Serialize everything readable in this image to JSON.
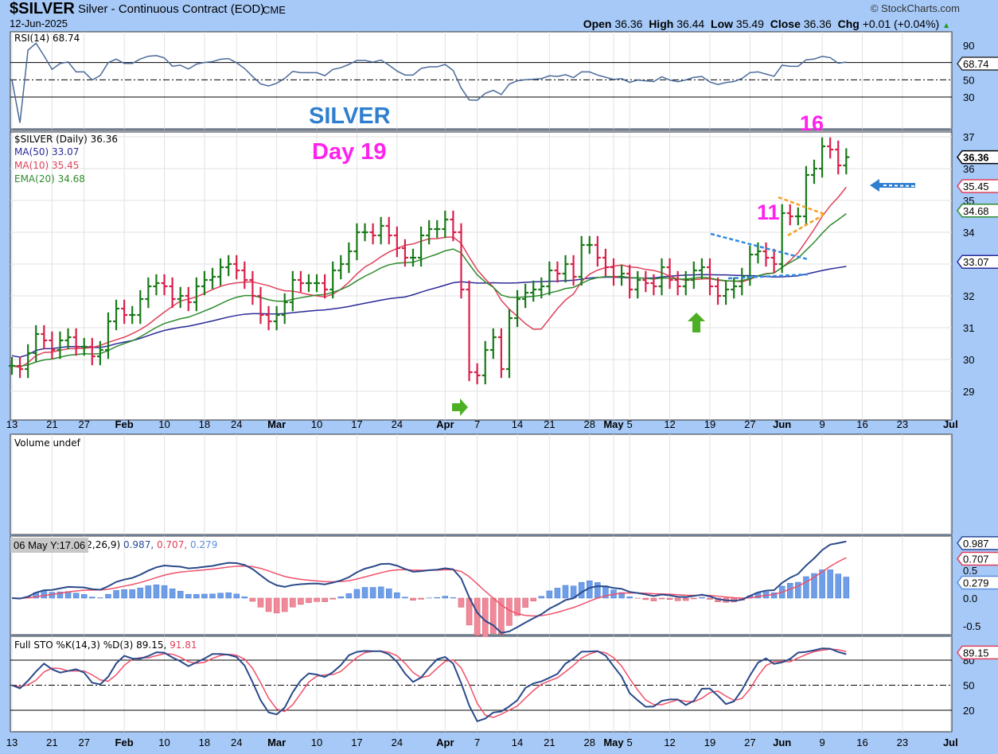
{
  "header": {
    "symbol": "$SILVER",
    "name": "Silver - Continuous Contract (EOD)",
    "exchange": "CME",
    "date": "12-Jun-2025",
    "copyright": "© StockCharts.com",
    "open_label": "Open",
    "open": "36.36",
    "high_label": "High",
    "high": "36.44",
    "low_label": "Low",
    "low": "35.49",
    "close_label": "Close",
    "close": "36.36",
    "chg_label": "Chg",
    "chg": "+0.01 (+0.04%)"
  },
  "colors": {
    "bg": "#a6c9f7",
    "up": "#1a7a1a",
    "down": "#d8204a",
    "ma50": "#2a2a9a",
    "ma10": "#e0405a",
    "ema20": "#2e8b2e",
    "annot_pink": "#ff22ee",
    "annot_blue": "#2f7fd0"
  },
  "legends": {
    "rsi": "RSI(14) 68.74",
    "price": "$SILVER (Daily) 36.36",
    "ma50": "MA(50) 33.07",
    "ma10": "MA(10) 35.45",
    "ema20": "EMA(20) 34.68",
    "volume": "Volume undef",
    "macd_prefix": "MACD(12,26,9)",
    "macd_v1": "0.987,",
    "macd_v2": "0.707,",
    "macd_v3": "0.279",
    "tooltip": "06 May Y:17.06",
    "sto": "Full STO %K(14,3) %D(3) 89.15,",
    "sto_d": "91.81"
  },
  "annotations": {
    "title": "SILVER",
    "day": "Day 19",
    "peak_count": "16",
    "mid_count": "11"
  },
  "chart_data": {
    "type": "ohlc",
    "title": "$SILVER Silver - Continuous Contract (EOD)",
    "closes": [
      29.8,
      29.7,
      30.2,
      30.8,
      30.6,
      30.3,
      30.6,
      30.7,
      30.4,
      30.4,
      30.1,
      30.3,
      31.2,
      31.6,
      31.4,
      31.4,
      31.9,
      32.3,
      32.4,
      32.3,
      31.9,
      32.0,
      31.8,
      32.3,
      32.5,
      32.6,
      32.9,
      33.0,
      32.8,
      32.5,
      32.0,
      31.4,
      31.2,
      31.4,
      31.8,
      32.5,
      32.4,
      32.4,
      32.4,
      32.2,
      32.8,
      33.0,
      33.4,
      34.0,
      34.0,
      33.9,
      34.2,
      33.9,
      33.5,
      33.2,
      33.2,
      33.9,
      34.1,
      34.1,
      34.4,
      34.0,
      32.2,
      29.6,
      29.5,
      30.3,
      30.7,
      29.7,
      31.3,
      31.9,
      32.1,
      32.2,
      32.3,
      32.8,
      32.7,
      33.0,
      32.6,
      33.6,
      33.6,
      33.2,
      32.9,
      32.6,
      32.7,
      32.2,
      32.5,
      32.4,
      32.3,
      32.9,
      32.5,
      32.3,
      32.5,
      32.8,
      32.9,
      32.3,
      32.0,
      32.2,
      32.3,
      32.6,
      33.3,
      33.4,
      33.2,
      33.0,
      34.6,
      34.5,
      34.5,
      35.8,
      36.0,
      36.7,
      36.6,
      36.1,
      36.36
    ],
    "price_axis": [
      "37",
      "36",
      "35",
      "34",
      "32",
      "31",
      "30",
      "29"
    ],
    "price_tags": [
      {
        "label": "36.36",
        "value": 36.36,
        "color": "#000000"
      },
      {
        "label": "35.45",
        "value": 35.45,
        "color": "#e0405a"
      },
      {
        "label": "34.68",
        "value": 34.68,
        "color": "#2e8b2e"
      },
      {
        "label": "33.07",
        "value": 33.07,
        "color": "#2a2a9a"
      }
    ],
    "x_labels": [
      {
        "label": "13",
        "i": 0
      },
      {
        "label": "21",
        "i": 5
      },
      {
        "label": "27",
        "i": 9
      },
      {
        "label": "Feb",
        "i": 14,
        "bold": true
      },
      {
        "label": "10",
        "i": 19
      },
      {
        "label": "18",
        "i": 24
      },
      {
        "label": "24",
        "i": 28
      },
      {
        "label": "Mar",
        "i": 33,
        "bold": true
      },
      {
        "label": "10",
        "i": 38
      },
      {
        "label": "17",
        "i": 43
      },
      {
        "label": "24",
        "i": 48
      },
      {
        "label": "Apr",
        "i": 54,
        "bold": true
      },
      {
        "label": "7",
        "i": 58
      },
      {
        "label": "14",
        "i": 63
      },
      {
        "label": "21",
        "i": 67
      },
      {
        "label": "28",
        "i": 72
      },
      {
        "label": "May",
        "i": 75,
        "bold": true
      },
      {
        "label": "5",
        "i": 77
      },
      {
        "label": "12",
        "i": 82
      },
      {
        "label": "19",
        "i": 87
      },
      {
        "label": "27",
        "i": 92
      },
      {
        "label": "Jun",
        "i": 96,
        "bold": true
      },
      {
        "label": "9",
        "i": 101
      },
      {
        "label": "16",
        "i": 106
      },
      {
        "label": "23",
        "i": 111
      },
      {
        "label": "Jul",
        "i": 117,
        "bold": true
      }
    ],
    "rsi_axis": [
      "90",
      "50",
      "30"
    ],
    "rsi_tag": "68.74",
    "macd_axis": [
      "0.5",
      "0.0",
      "-0.5"
    ],
    "macd_tags": [
      {
        "label": "0.987",
        "value": 0.987,
        "color": "#2a4a9a"
      },
      {
        "label": "0.707",
        "value": 0.707,
        "color": "#e0405a"
      },
      {
        "label": "0.279",
        "value": 0.279,
        "color": "#5a8ee0"
      }
    ],
    "sto_axis": [
      "80",
      "50",
      "20"
    ],
    "sto_tag": "89.15"
  }
}
